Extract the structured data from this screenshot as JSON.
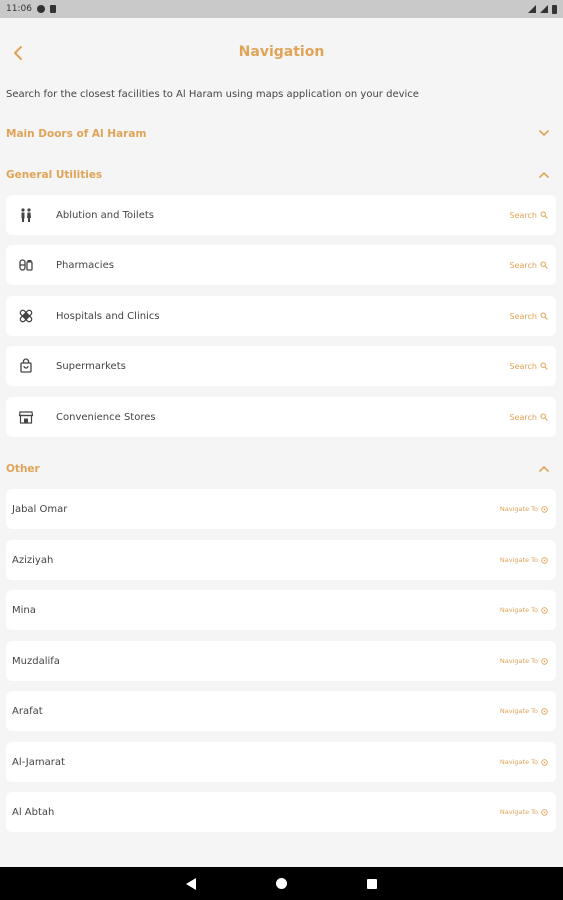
{
  "status_bar": {
    "time": "11:06"
  },
  "header": {
    "title": "Navigation",
    "back_icon": "chevron-left-icon"
  },
  "intro_text": "Search for the closest facilities to Al Haram using maps application on your device",
  "sections": {
    "main_doors": {
      "title": "Main Doors of Al Haram",
      "expanded": false
    },
    "general_utilities": {
      "title": "General Utilities",
      "expanded": true,
      "action_label": "Search",
      "items": [
        {
          "label": "Ablution and Toilets",
          "icon": "restroom-icon"
        },
        {
          "label": "Pharmacies",
          "icon": "pharmacy-icon"
        },
        {
          "label": "Hospitals and Clinics",
          "icon": "bandage-icon"
        },
        {
          "label": "Supermarkets",
          "icon": "shopping-bag-icon"
        },
        {
          "label": "Convenience Stores",
          "icon": "store-icon"
        }
      ]
    },
    "other": {
      "title": "Other",
      "expanded": true,
      "action_label": "Navigate To",
      "items": [
        {
          "label": "Jabal Omar"
        },
        {
          "label": "Aziziyah"
        },
        {
          "label": "Mina"
        },
        {
          "label": "Muzdalifa"
        },
        {
          "label": "Arafat"
        },
        {
          "label": "Al-Jamarat"
        },
        {
          "label": "Al Abtah"
        }
      ]
    }
  },
  "colors": {
    "accent": "#e0a457",
    "background": "#f5f5f5",
    "card": "#ffffff"
  }
}
